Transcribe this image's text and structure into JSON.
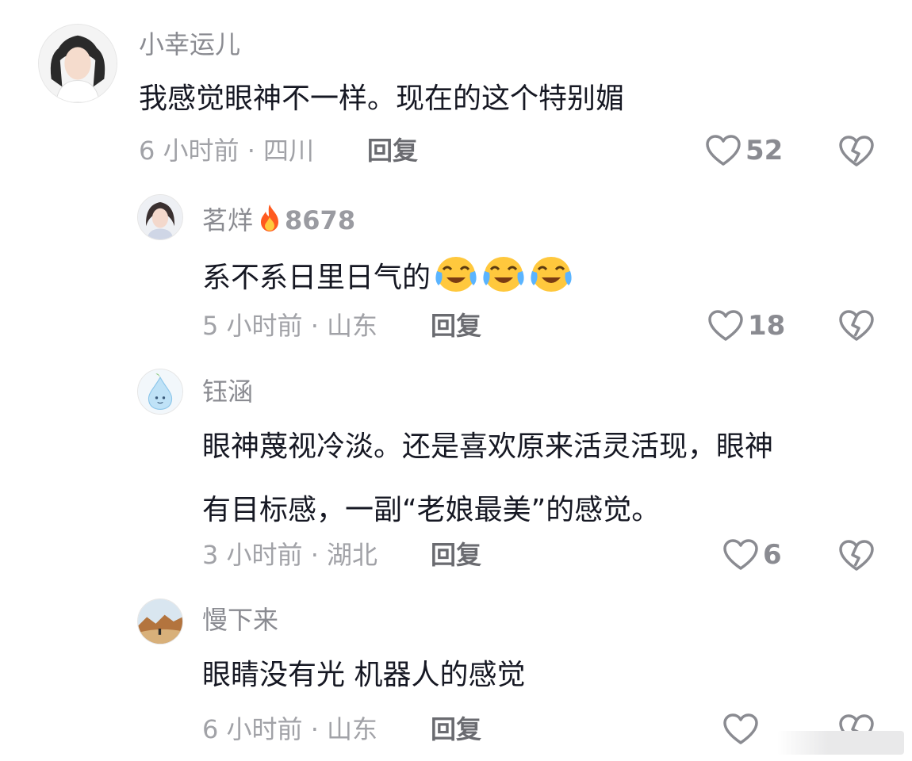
{
  "comments": [
    {
      "username": "小幸运儿",
      "text": "我感觉眼神不一样。现在的这个特别媚",
      "time_location": "6 小时前 · 四川",
      "reply_label": "回复",
      "likes": "52",
      "avatar_icon": "woman-portrait"
    },
    {
      "username": "茗烊",
      "fire_icon": "fire-icon",
      "fire_score": "8678",
      "text": "系不系日里日气的",
      "emojis": [
        "crying-laughing-emoji",
        "crying-laughing-emoji",
        "crying-laughing-emoji"
      ],
      "time_location": "5 小时前 · 山东",
      "reply_label": "回复",
      "likes": "18",
      "avatar_icon": "woman-portrait"
    },
    {
      "username": "钰涵",
      "text_lines": [
        "眼神蔑视冷淡。还是喜欢原来活灵活现，眼神",
        "有目标感，一副“老娘最美”的感觉。"
      ],
      "time_location": "3 小时前 · 湖北",
      "reply_label": "回复",
      "likes": "6",
      "avatar_icon": "water-drop-character"
    },
    {
      "username": "慢下来",
      "text": "眼睛没有光  机器人的感觉",
      "time_location": "6 小时前 · 山东",
      "reply_label": "回复",
      "avatar_icon": "landscape-photo"
    }
  ],
  "colors": {
    "text": "#161823",
    "muted": "#a1a2a7",
    "username": "#8a8b91",
    "reply": "#6a6b70"
  }
}
